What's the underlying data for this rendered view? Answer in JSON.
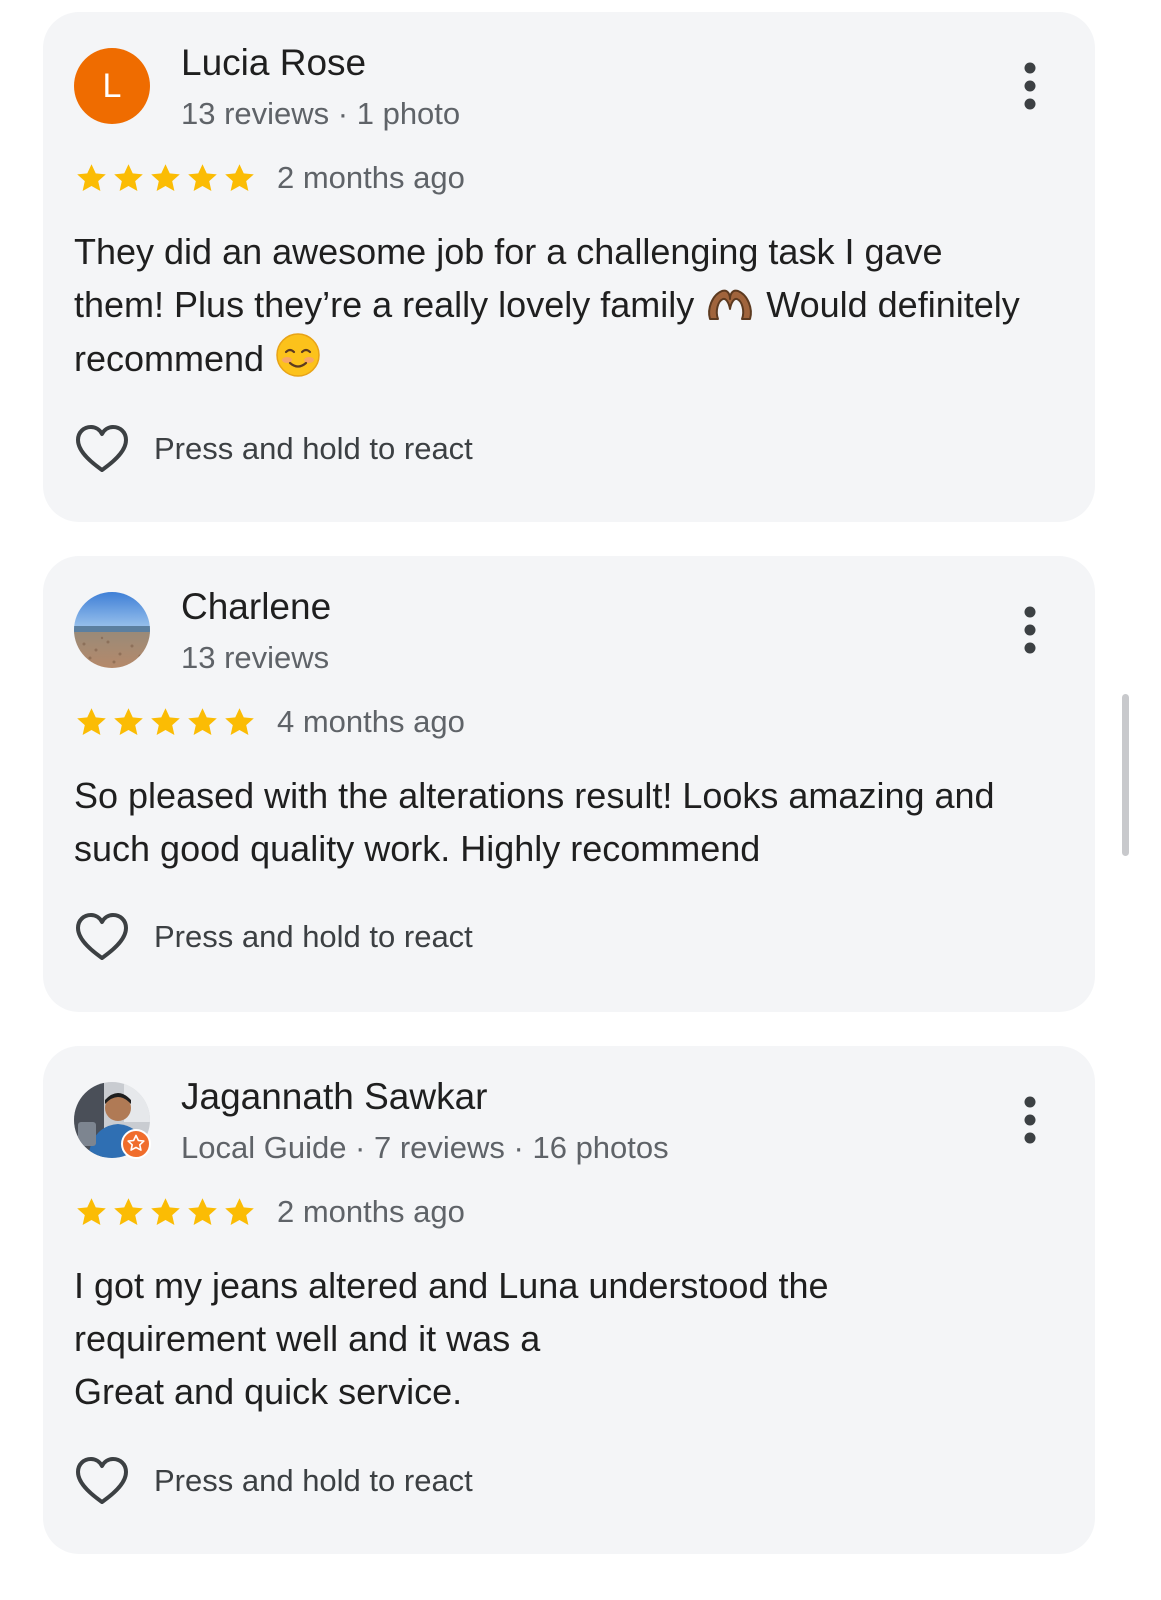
{
  "reviews": [
    {
      "author": "Lucia Rose",
      "avatar_letter": "L",
      "meta": "13 reviews · 1 photo",
      "rating": 5,
      "max_rating": 5,
      "date": "2 months ago",
      "text_lines": [
        "They did an awesome job for a challenging task I gave",
        "them! Plus they’re a really lovely family",
        "Would definitely",
        "recommend"
      ],
      "react_label": "Press and hold to react"
    },
    {
      "author": "Charlene",
      "meta": "13 reviews",
      "rating": 5,
      "max_rating": 5,
      "date": "4 months ago",
      "text_lines": [
        "So pleased with the alterations result! Looks amazing and",
        "such good quality work. Highly recommend"
      ],
      "react_label": "Press and hold to react"
    },
    {
      "author": "Jagannath Sawkar",
      "meta": "Local Guide · 7 reviews · 16 photos",
      "rating": 5,
      "max_rating": 5,
      "date": "2 months ago",
      "text_lines": [
        "I got my jeans altered and Luna understood the",
        "requirement well and it was a",
        "Great and quick service."
      ],
      "react_label": "Press and hold to react"
    }
  ],
  "colors": {
    "card_background": "#f4f5f7",
    "star": "#fbbc04",
    "avatar_letter_bg": "#ef6c00",
    "secondary_text": "#5f6368"
  },
  "icons": {
    "menu": "more-vert-icon",
    "react": "heart-outline-icon",
    "rating": "star-icon",
    "badge": "local-guide-star-icon"
  }
}
